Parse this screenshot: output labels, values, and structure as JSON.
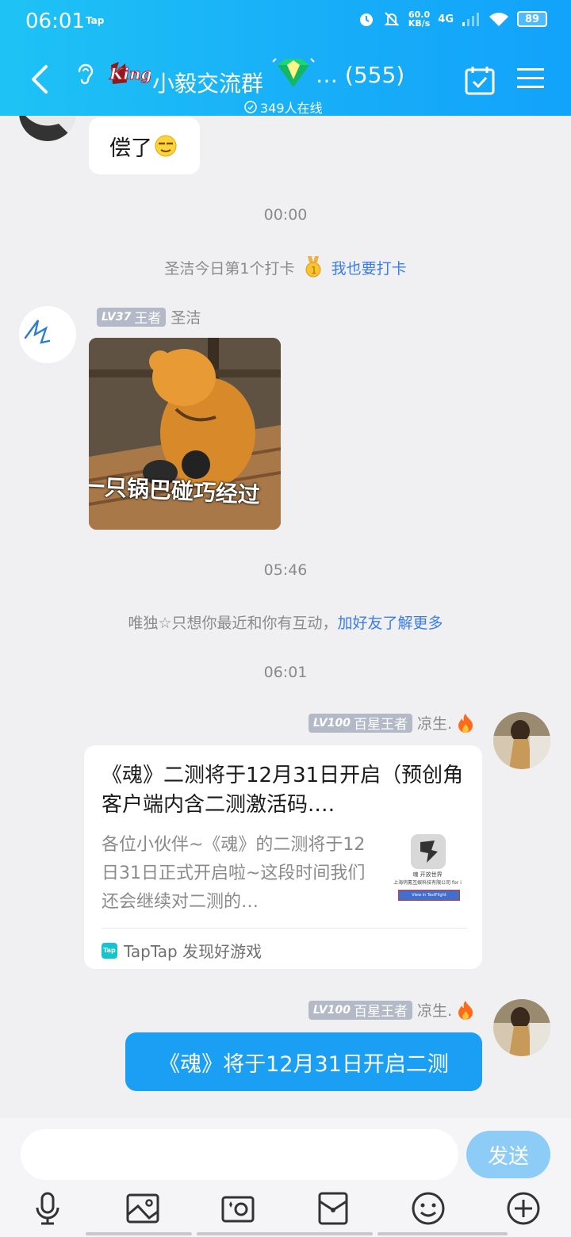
{
  "status_bar": {
    "time": "06:01",
    "app_tag": "Tap",
    "net_speed_value": "60.0",
    "net_speed_unit": "KB/s",
    "network": "4G",
    "battery": "89"
  },
  "header": {
    "group_name": "小毅交流群",
    "ellipsis": "…",
    "member_count": "(555)",
    "online": "349人在线",
    "colors": {
      "gradient_start": "#1ec3f5",
      "gradient_end": "#12a3fb"
    }
  },
  "chat": {
    "top_partial_message": {
      "text": "偿了"
    },
    "timestamps": [
      "00:00",
      "05:46",
      "06:01"
    ],
    "checkin": {
      "text": "圣洁今日第1个打卡",
      "link": "我也要打卡"
    },
    "message_sticker": {
      "level": "LV37",
      "title": "王者",
      "sender": "圣洁",
      "sticker_caption": "一只锅巴碰巧经过"
    },
    "friend_hint": {
      "text": "唯独☆只想你最近和你有互动，",
      "link": "加好友了解更多"
    },
    "message_card": {
      "level": "LV100",
      "title": "百星王者",
      "sender": "凉生.",
      "card_title": "《魂》二测将于12月31日开启（预创角客户端内含二测激活码.…",
      "card_desc": "各位小伙伴~《魂》的二测将于12日31日正式开启啦~这段时间我们还会继续对二测的…",
      "thumb_caption": "魂 开放世界",
      "thumb_company": "上海钨氪互娱科技有限公司 for i",
      "thumb_button": "View in TestFlight",
      "source_icon": "Tap",
      "source": "TapTap 发现好游戏"
    },
    "message_text": {
      "level": "LV100",
      "title": "百星王者",
      "sender": "凉生.",
      "text": "《魂》将于12月31日开启二测"
    }
  },
  "input_bar": {
    "placeholder": "",
    "send_label": "发送",
    "tools": [
      "microphone-icon",
      "image-icon",
      "camera-icon",
      "red-packet-icon",
      "emoji-icon",
      "plus-icon"
    ]
  }
}
